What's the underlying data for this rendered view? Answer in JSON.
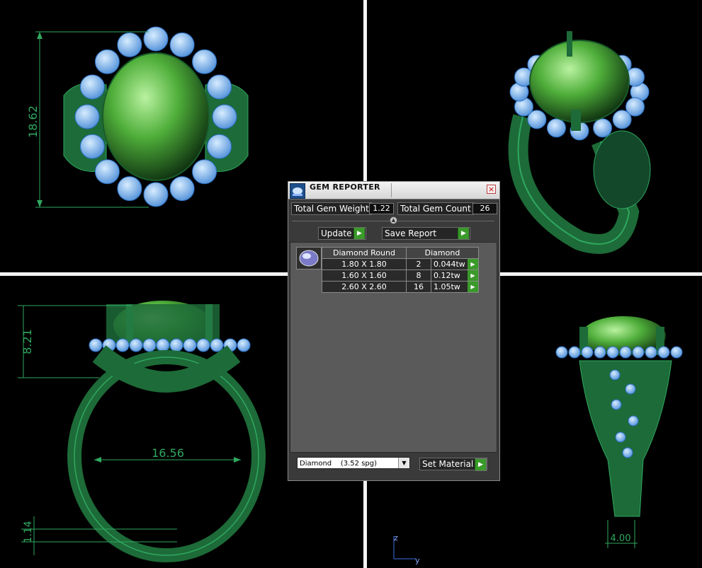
{
  "viewports": {
    "top": {
      "dimension": "18.62"
    },
    "front": {
      "height_dimension": "8.21",
      "width_dimension": "16.56",
      "band_dimension": "1.14"
    },
    "side": {
      "dimension": "4.00"
    },
    "axes": {
      "z_label": "z",
      "y_label": "y"
    }
  },
  "gem_reporter": {
    "title": "GEM REPORTER",
    "total_weight_label": "Total Gem Weight",
    "total_weight_value": "1.22",
    "total_count_label": "Total Gem Count",
    "total_count_value": "26",
    "update_label": "Update",
    "save_report_label": "Save Report",
    "table": {
      "headers": [
        "Diamond Round",
        "Diamond"
      ],
      "rows": [
        {
          "size": "1.80 X 1.80",
          "count": "2",
          "weight": "0.044tw"
        },
        {
          "size": "1.60 X 1.60",
          "count": "8",
          "weight": "0.12tw"
        },
        {
          "size": "2.60 X 2.60",
          "count": "16",
          "weight": "1.05tw"
        }
      ]
    },
    "material_select": "Diamond    (3.52 spg)",
    "set_material_label": "Set Material"
  },
  "colors": {
    "metal": "#1f7a3f",
    "gem": "#6fb8ff",
    "stone": "#58c24a",
    "accent_green": "#3a9a2a"
  }
}
